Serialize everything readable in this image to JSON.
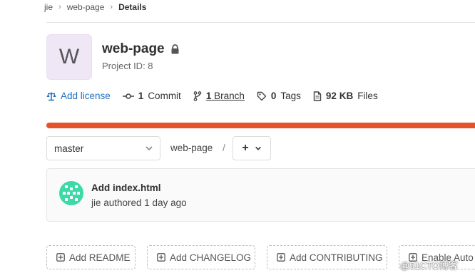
{
  "breadcrumb": {
    "items": [
      "jie",
      "web-page",
      "Details"
    ]
  },
  "project": {
    "avatar_letter": "W",
    "name": "web-page",
    "id_text": "Project ID: 8"
  },
  "stats": {
    "license_label": "Add license",
    "commits_count": "1",
    "commits_label": "Commit",
    "branches_count": "1",
    "branches_label": "Branch",
    "tags_count": "0",
    "tags_label": "Tags",
    "files_size": "92 KB",
    "files_label": "Files"
  },
  "progress": {
    "percent": 100,
    "color": "#e4532a"
  },
  "repo_nav": {
    "branch": "master",
    "path": "web-page",
    "path_separator": "/",
    "add_symbol": "+"
  },
  "last_commit": {
    "message": "Add index.html",
    "meta": "jie authored 1 day ago"
  },
  "quick_actions": [
    {
      "label": "Add README"
    },
    {
      "label": "Add CHANGELOG"
    },
    {
      "label": "Add CONTRIBUTING"
    },
    {
      "label": "Enable Auto"
    }
  ],
  "watermark": "@51CTO博客",
  "icons": {
    "license": "scale-icon",
    "commit": "commit-icon",
    "branch": "branch-icon",
    "tag": "tag-icon",
    "files": "file-icon",
    "lock": "lock-icon"
  },
  "colors": {
    "accent_link": "#1f6fbf",
    "identicon": "#3dd9a7"
  }
}
